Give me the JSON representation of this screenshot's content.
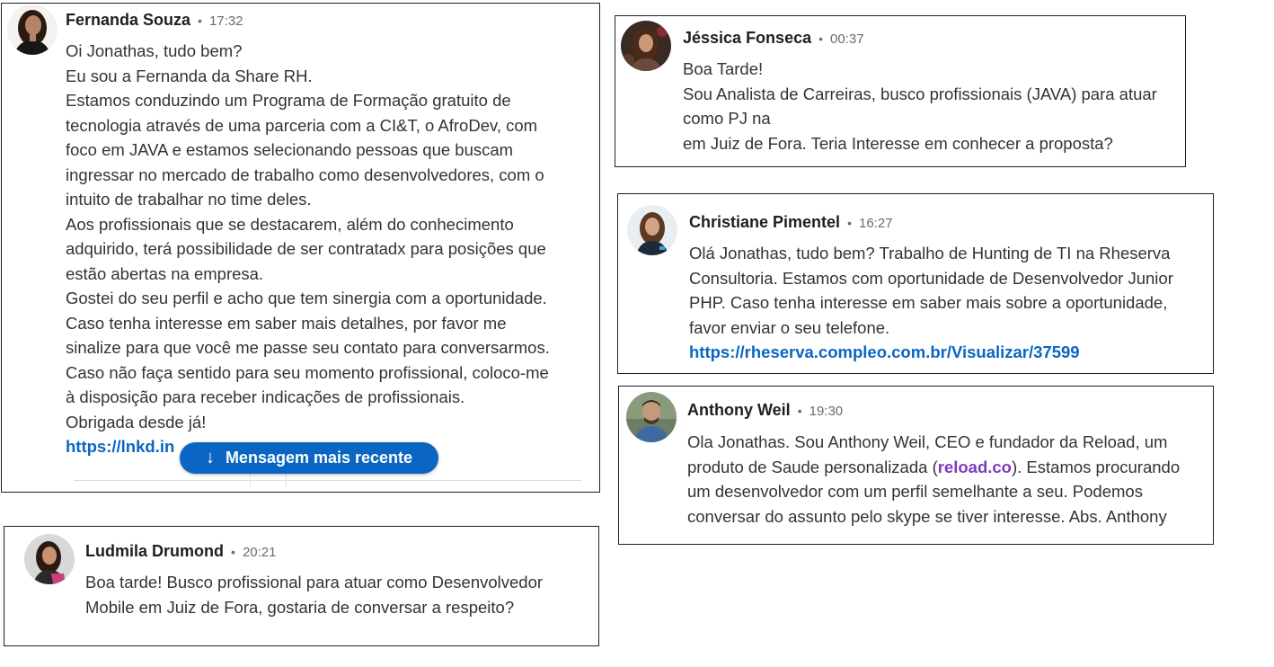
{
  "messages": {
    "fernanda": {
      "name": "Fernanda Souza",
      "sep": "•",
      "time": "17:32",
      "lines": [
        "Oi Jonathas, tudo bem?",
        "Eu sou a Fernanda da Share RH.",
        "Estamos conduzindo um Programa de Formação gratuito de",
        "tecnologia através de uma parceria com a CI&T, o AfroDev, com",
        "foco em JAVA e estamos selecionando pessoas que buscam",
        "ingressar no mercado de trabalho como desenvolvedores, com o",
        "intuito de trabalhar no time deles.",
        "Aos profissionais que se destacarem, além do conhecimento",
        "adquirido, terá possibilidade de ser contratadx para posições que",
        "estão abertas na empresa.",
        "Gostei do seu perfil e acho que tem sinergia com a oportunidade.",
        "Caso tenha interesse em saber mais detalhes, por favor me",
        "sinalize para que você me passe seu contato para conversarmos.",
        "Caso não faça sentido para seu momento profissional, coloco-me",
        "à disposição para receber indicações de profissionais.",
        "Obrigada desde já!"
      ],
      "link": "https://lnkd.in",
      "new_message_button": "Mensagem mais recente"
    },
    "jessica": {
      "name": "Jéssica Fonseca",
      "sep": "•",
      "time": "00:37",
      "lines": [
        "Boa Tarde!",
        "Sou Analista de Carreiras, busco profissionais (JAVA) para atuar",
        "como PJ na",
        "em Juiz de Fora. Teria Interesse em conhecer a proposta?"
      ]
    },
    "christiane": {
      "name": "Christiane Pimentel",
      "sep": "•",
      "time": "16:27",
      "lines": [
        "Olá Jonathas, tudo bem? Trabalho de Hunting de TI  na Rheserva",
        "Consultoria. Estamos com oportunidade de Desenvolvedor Junior",
        "PHP. Caso tenha interesse em saber mais sobre a oportunidade,",
        "favor enviar o seu telefone."
      ],
      "link": "https://rheserva.compleo.com.br/Visualizar/37599"
    },
    "anthony": {
      "name": "Anthony Weil",
      "sep": "•",
      "time": "19:30",
      "line1": "Ola Jonathas. Sou Anthony Weil, CEO e fundador da Reload, um",
      "line2_pre": "produto de Saude personalizada (",
      "line2_link": "reload.co",
      "line2_post": "). Estamos procurando",
      "line3": "um desenvolvedor com um perfil semelhante a seu. Podemos",
      "line4": "conversar do assunto pelo skype se tiver interesse. Abs. Anthony"
    },
    "ludmila": {
      "name": "Ludmila Drumond",
      "sep": "•",
      "time": "20:21",
      "lines": [
        "Boa tarde! Busco profissional para atuar como Desenvolvedor",
        "Mobile em Juiz de Fora, gostaria de conversar a respeito?"
      ]
    }
  },
  "colors": {
    "link": "#0a66c2",
    "link_visited": "#7d3cbe",
    "pill_bg": "#0a66c2"
  },
  "icons": {
    "pill": "arrow-down-icon"
  }
}
